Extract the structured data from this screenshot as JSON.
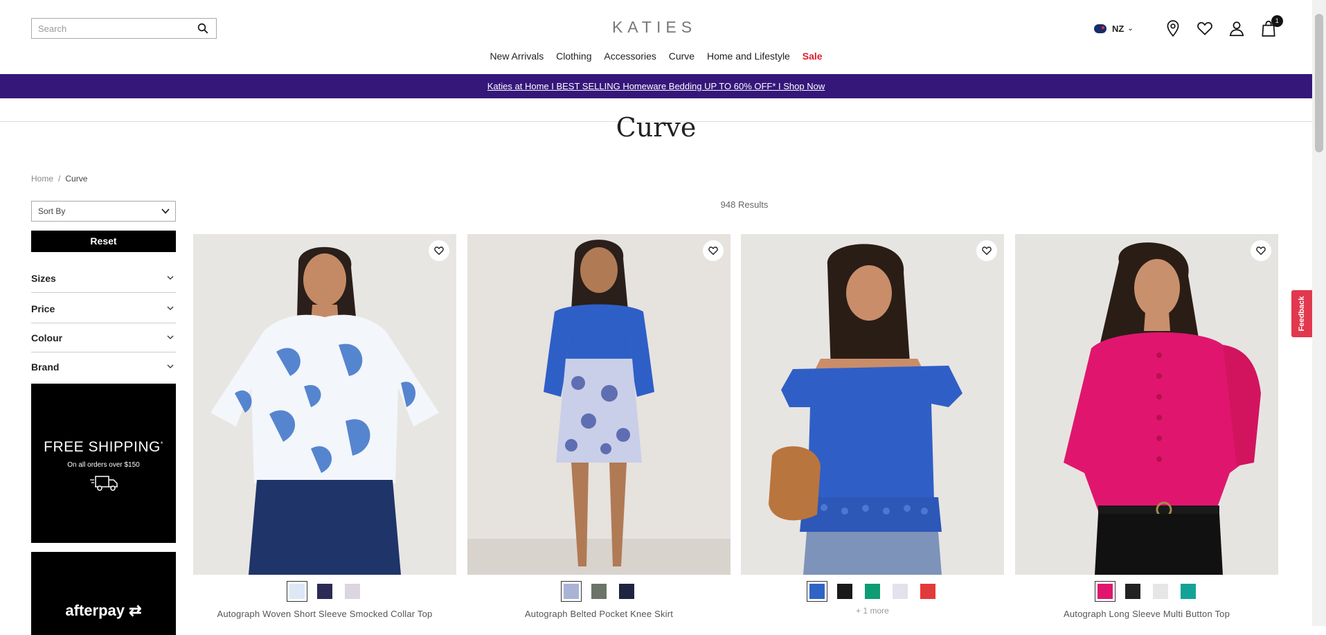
{
  "header": {
    "search_placeholder": "Search",
    "logo": "KATIES",
    "locale": "NZ",
    "cart_count": "1"
  },
  "nav": {
    "items": [
      "New Arrivals",
      "Clothing",
      "Accessories",
      "Curve",
      "Home and Lifestyle"
    ],
    "sale": "Sale"
  },
  "promo": {
    "text": "Katies at Home I BEST SELLING Homeware Bedding UP TO 60% OFF* I Shop Now",
    "color": "#35177a"
  },
  "page": {
    "title": "Curve",
    "breadcrumb_home": "Home",
    "breadcrumb_sep": "/",
    "breadcrumb_current": "Curve",
    "results": "948 Results"
  },
  "sidebar": {
    "sort_label": "Sort By",
    "reset_label": "Reset",
    "filters": [
      "Sizes",
      "Price",
      "Colour",
      "Brand"
    ],
    "shipping_title": "FREE SHIPPING",
    "shipping_mark": "*",
    "shipping_sub": "On all orders over $150",
    "afterpay": "afterpay"
  },
  "products": [
    {
      "name": "Autograph Woven Short Sleeve Smocked Collar Top",
      "swatches": [
        "#dce8f6",
        "#2b2b55",
        "#dcd6e0"
      ],
      "more": ""
    },
    {
      "name": "Autograph Belted Pocket Knee Skirt",
      "swatches": [
        "#aab3d6",
        "#6b7466",
        "#1f2440"
      ],
      "more": ""
    },
    {
      "name": "",
      "swatches": [
        "#2f63c6",
        "#1a1a1a",
        "#0f9b73",
        "#e2e2ec",
        "#e23a3a"
      ],
      "more": "+ 1 more"
    },
    {
      "name": "Autograph Long Sleeve Multi Button Top",
      "swatches": [
        "#e0166e",
        "#222222",
        "#e6e6e6",
        "#13a396"
      ],
      "more": ""
    }
  ],
  "feedback": "Feedback"
}
